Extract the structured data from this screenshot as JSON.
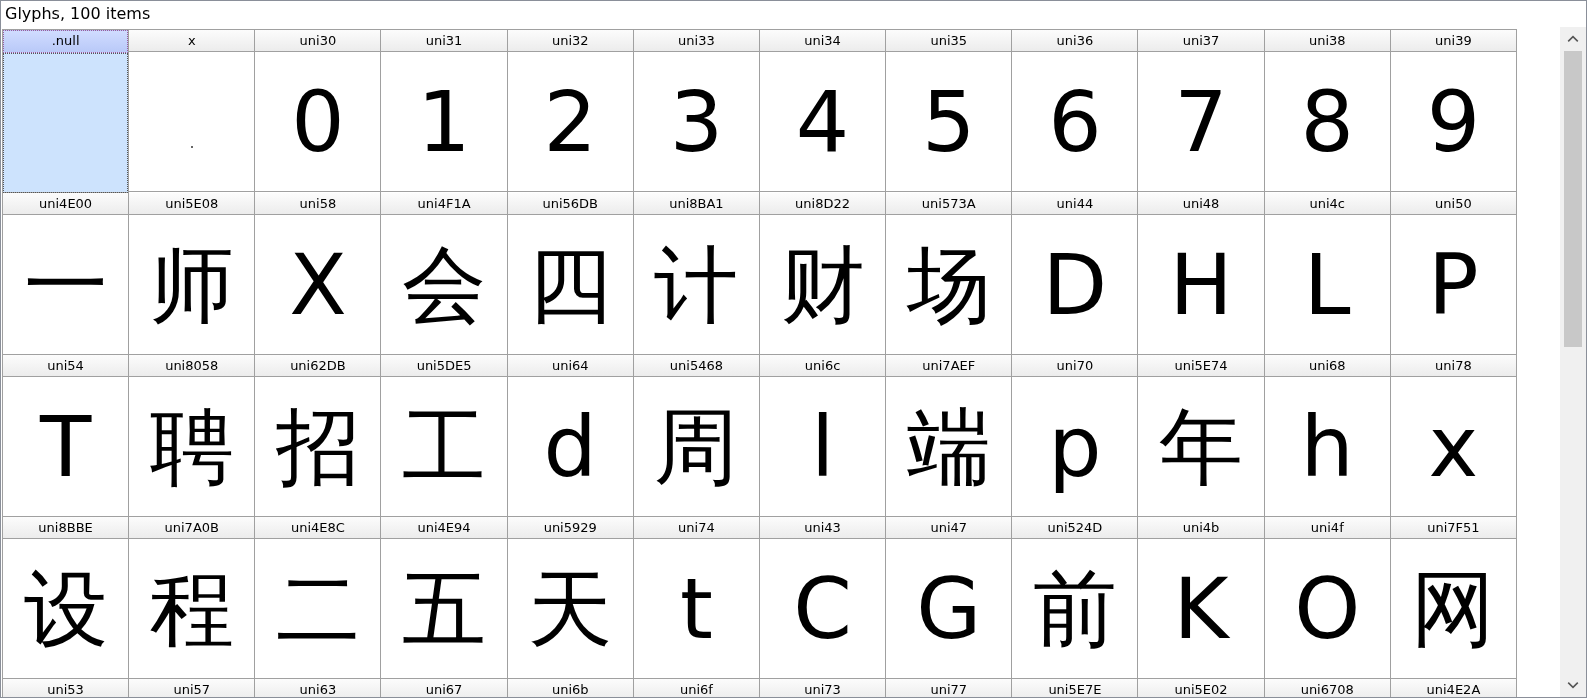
{
  "title": "Glyphs, 100 items",
  "rows": [
    {
      "cells": [
        {
          "name": ".null",
          "kind": "blank",
          "selected": true
        },
        {
          "name": "x",
          "kind": "dot",
          "selected": false
        },
        {
          "name": "uni30",
          "kind": "char",
          "glyph": "0",
          "selected": false
        },
        {
          "name": "uni31",
          "kind": "char",
          "glyph": "1",
          "selected": false
        },
        {
          "name": "uni32",
          "kind": "char",
          "glyph": "2",
          "selected": false
        },
        {
          "name": "uni33",
          "kind": "char",
          "glyph": "3",
          "selected": false
        },
        {
          "name": "uni34",
          "kind": "char",
          "glyph": "4",
          "selected": false
        },
        {
          "name": "uni35",
          "kind": "char",
          "glyph": "5",
          "selected": false
        },
        {
          "name": "uni36",
          "kind": "char",
          "glyph": "6",
          "selected": false
        },
        {
          "name": "uni37",
          "kind": "char",
          "glyph": "7",
          "selected": false
        },
        {
          "name": "uni38",
          "kind": "char",
          "glyph": "8",
          "selected": false
        },
        {
          "name": "uni39",
          "kind": "char",
          "glyph": "9",
          "selected": false
        }
      ]
    },
    {
      "cells": [
        {
          "name": "uni4E00",
          "kind": "char",
          "glyph": "一",
          "selected": false
        },
        {
          "name": "uni5E08",
          "kind": "char",
          "glyph": "师",
          "selected": false
        },
        {
          "name": "uni58",
          "kind": "char",
          "glyph": "X",
          "selected": false
        },
        {
          "name": "uni4F1A",
          "kind": "char",
          "glyph": "会",
          "selected": false
        },
        {
          "name": "uni56DB",
          "kind": "char",
          "glyph": "四",
          "selected": false
        },
        {
          "name": "uni8BA1",
          "kind": "char",
          "glyph": "计",
          "selected": false
        },
        {
          "name": "uni8D22",
          "kind": "char",
          "glyph": "财",
          "selected": false
        },
        {
          "name": "uni573A",
          "kind": "char",
          "glyph": "场",
          "selected": false
        },
        {
          "name": "uni44",
          "kind": "char",
          "glyph": "D",
          "selected": false
        },
        {
          "name": "uni48",
          "kind": "char",
          "glyph": "H",
          "selected": false
        },
        {
          "name": "uni4c",
          "kind": "char",
          "glyph": "L",
          "selected": false
        },
        {
          "name": "uni50",
          "kind": "char",
          "glyph": "P",
          "selected": false
        }
      ]
    },
    {
      "cells": [
        {
          "name": "uni54",
          "kind": "char",
          "glyph": "T",
          "selected": false
        },
        {
          "name": "uni8058",
          "kind": "char",
          "glyph": "聘",
          "selected": false
        },
        {
          "name": "uni62DB",
          "kind": "char",
          "glyph": "招",
          "selected": false
        },
        {
          "name": "uni5DE5",
          "kind": "char",
          "glyph": "工",
          "selected": false
        },
        {
          "name": "uni64",
          "kind": "char",
          "glyph": "d",
          "selected": false
        },
        {
          "name": "uni5468",
          "kind": "char",
          "glyph": "周",
          "selected": false
        },
        {
          "name": "uni6c",
          "kind": "char",
          "glyph": "l",
          "selected": false
        },
        {
          "name": "uni7AEF",
          "kind": "char",
          "glyph": "端",
          "selected": false
        },
        {
          "name": "uni70",
          "kind": "char",
          "glyph": "p",
          "selected": false
        },
        {
          "name": "uni5E74",
          "kind": "char",
          "glyph": "年",
          "selected": false
        },
        {
          "name": "uni68",
          "kind": "char",
          "glyph": "h",
          "selected": false
        },
        {
          "name": "uni78",
          "kind": "char",
          "glyph": "x",
          "selected": false
        }
      ]
    },
    {
      "cells": [
        {
          "name": "uni8BBE",
          "kind": "char",
          "glyph": "设",
          "selected": false
        },
        {
          "name": "uni7A0B",
          "kind": "char",
          "glyph": "程",
          "selected": false
        },
        {
          "name": "uni4E8C",
          "kind": "char",
          "glyph": "二",
          "selected": false
        },
        {
          "name": "uni4E94",
          "kind": "char",
          "glyph": "五",
          "selected": false
        },
        {
          "name": "uni5929",
          "kind": "char",
          "glyph": "天",
          "selected": false
        },
        {
          "name": "uni74",
          "kind": "char",
          "glyph": "t",
          "selected": false
        },
        {
          "name": "uni43",
          "kind": "char",
          "glyph": "C",
          "selected": false
        },
        {
          "name": "uni47",
          "kind": "char",
          "glyph": "G",
          "selected": false
        },
        {
          "name": "uni524D",
          "kind": "char",
          "glyph": "前",
          "selected": false
        },
        {
          "name": "uni4b",
          "kind": "char",
          "glyph": "K",
          "selected": false
        },
        {
          "name": "uni4f",
          "kind": "char",
          "glyph": "O",
          "selected": false
        },
        {
          "name": "uni7F51",
          "kind": "char",
          "glyph": "网",
          "selected": false
        }
      ]
    },
    {
      "cells": [
        {
          "name": "uni53",
          "selected": false
        },
        {
          "name": "uni57",
          "selected": false
        },
        {
          "name": "uni63",
          "selected": false
        },
        {
          "name": "uni67",
          "selected": false
        },
        {
          "name": "uni6b",
          "selected": false
        },
        {
          "name": "uni6f",
          "selected": false
        },
        {
          "name": "uni73",
          "selected": false
        },
        {
          "name": "uni77",
          "selected": false
        },
        {
          "name": "uni5E7E",
          "selected": false
        },
        {
          "name": "uni5E02",
          "selected": false
        },
        {
          "name": "uni6708",
          "selected": false
        },
        {
          "name": "uni4E2A",
          "selected": false
        }
      ]
    }
  ]
}
